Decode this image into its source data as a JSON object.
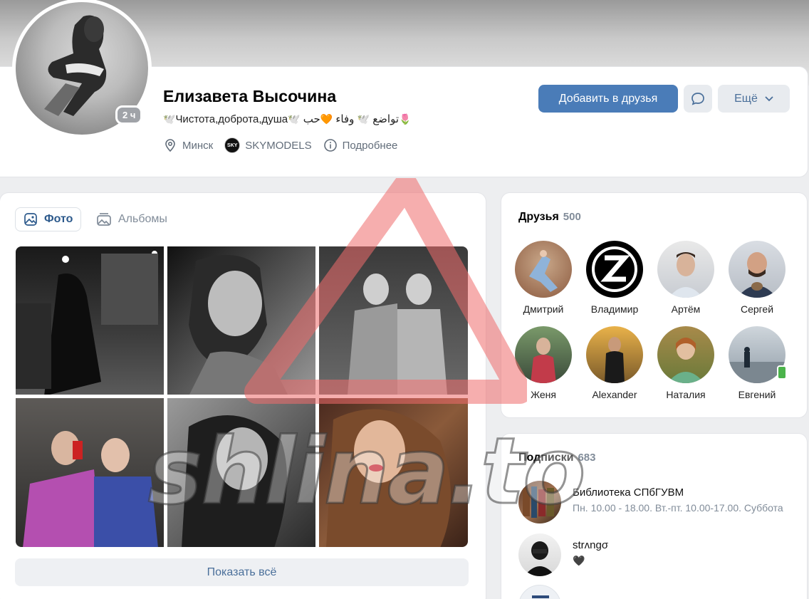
{
  "profile": {
    "name": "Елизавета Высочина",
    "online_badge": "2 ч",
    "status_parts": [
      "Чистота,доброта,душа",
      "تواضع",
      "وفاء",
      "حب"
    ],
    "location": "Минск",
    "work": "SKYMODELS",
    "work_logo_text": "SKY",
    "more_info": "Подробнее"
  },
  "actions": {
    "add_friend": "Добавить в друзья",
    "more": "Ещё"
  },
  "photos": {
    "tab_photos": "Фото",
    "tab_albums": "Альбомы",
    "show_all": "Показать всё"
  },
  "friends": {
    "title": "Друзья",
    "count": "500",
    "items": [
      {
        "name": "Дмитрий"
      },
      {
        "name": "Владимир"
      },
      {
        "name": "Артём"
      },
      {
        "name": "Сергей"
      },
      {
        "name": "Женя"
      },
      {
        "name": "Alexander"
      },
      {
        "name": "Наталия"
      },
      {
        "name": "Евгений"
      }
    ]
  },
  "subscriptions": {
    "title": "Подписки",
    "count": "683",
    "items": [
      {
        "name": "Библиотека СПбГУВМ",
        "desc": "Пн. 10.00 - 18.00. Вт.-пт. 10.00-17.00. Суббота"
      },
      {
        "name": "strᴧngσ",
        "desc": "🖤"
      }
    ]
  },
  "watermark": "shlina.to",
  "colors": {
    "primary": "#4a7cb8",
    "link": "#4a6f9a",
    "muted": "#818c99",
    "background": "#edeef0"
  }
}
